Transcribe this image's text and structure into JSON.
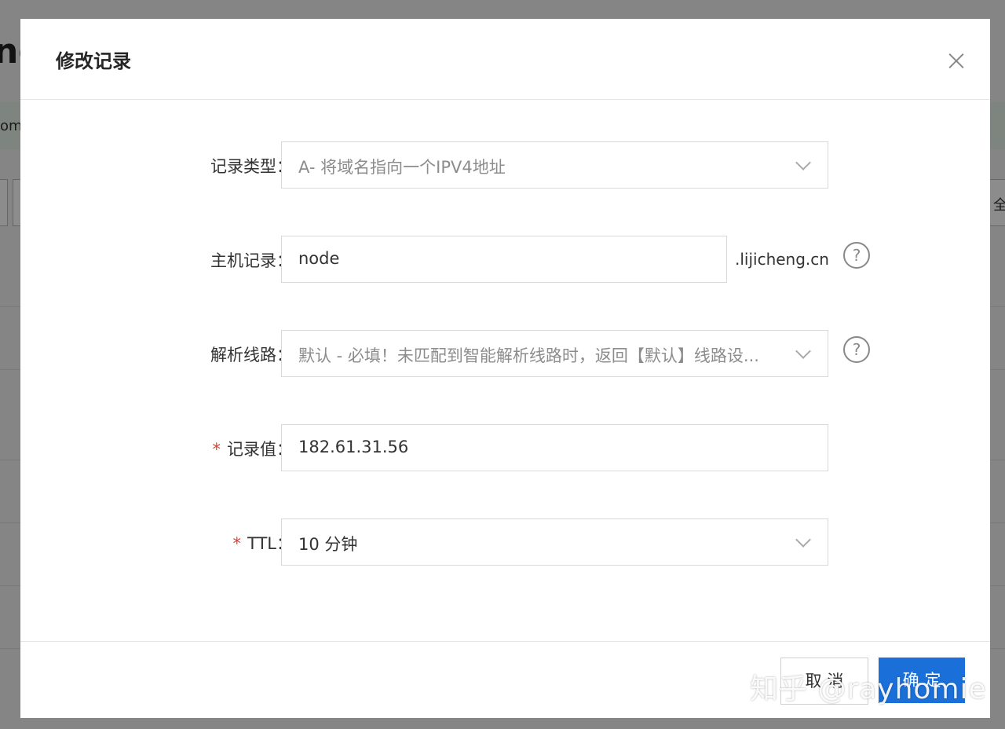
{
  "background": {
    "title_fragment": "ng",
    "notice_fragment": "om",
    "toolbar_fragment": "全"
  },
  "dialog": {
    "title": "修改记录",
    "close_icon": "close-icon"
  },
  "form": {
    "record_type": {
      "label": "记录类型：",
      "value": "A- 将域名指向一个IPV4地址"
    },
    "host": {
      "label": "主机记录：",
      "value": "node",
      "suffix": ".lijicheng.cn",
      "help": "?"
    },
    "line": {
      "label": "解析线路：",
      "value": "默认 - 必填！未匹配到智能解析线路时，返回【默认】线路设...",
      "help": "?"
    },
    "record_value": {
      "required": "*",
      "label": "记录值：",
      "value": "182.61.31.56"
    },
    "ttl": {
      "required": "*",
      "label": "TTL：",
      "value": "10 分钟"
    }
  },
  "footer": {
    "cancel_label": "取 消",
    "ok_label": "确 定"
  },
  "watermark": "知乎 @rayhomie",
  "colors": {
    "primary": "#1a6fd8",
    "required": "#e03c31"
  }
}
